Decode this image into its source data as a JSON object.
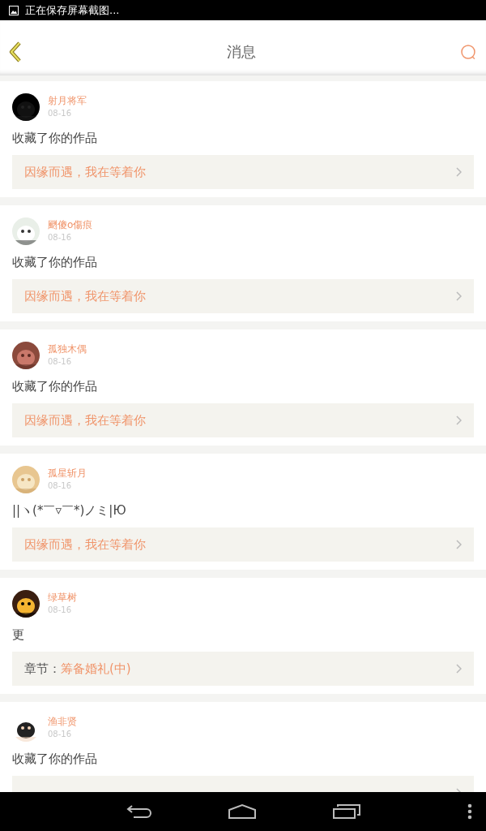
{
  "status_bar": {
    "text": "正在保存屏幕截图..."
  },
  "header": {
    "title": "消息"
  },
  "messages": [
    {
      "name": "射月将军",
      "date": "08-16",
      "text": "收藏了你的作品",
      "link": {
        "kind": "work",
        "title": "因缘而遇，我在等着你"
      }
    },
    {
      "name": "颲傻o傷痕",
      "date": "08-16",
      "text": "收藏了你的作品",
      "link": {
        "kind": "work",
        "title": "因缘而遇，我在等着你"
      }
    },
    {
      "name": "孤独木偶",
      "date": "08-16",
      "text": "收藏了你的作品",
      "link": {
        "kind": "work",
        "title": "因缘而遇，我在等着你"
      }
    },
    {
      "name": "孤星斩月",
      "date": "08-16",
      "text": "||ヽ(*￣▿￣*)ノミ|Ю",
      "link": {
        "kind": "work",
        "title": "因缘而遇，我在等着你"
      }
    },
    {
      "name": "绿草树",
      "date": "08-16",
      "text": "更",
      "link": {
        "kind": "chapter",
        "prefix": "章节：",
        "title": "筹备婚礼(中)"
      }
    },
    {
      "name": "渔非贤",
      "date": "08-16",
      "text": "收藏了你的作品",
      "link": {
        "kind": "work"
      }
    }
  ]
}
